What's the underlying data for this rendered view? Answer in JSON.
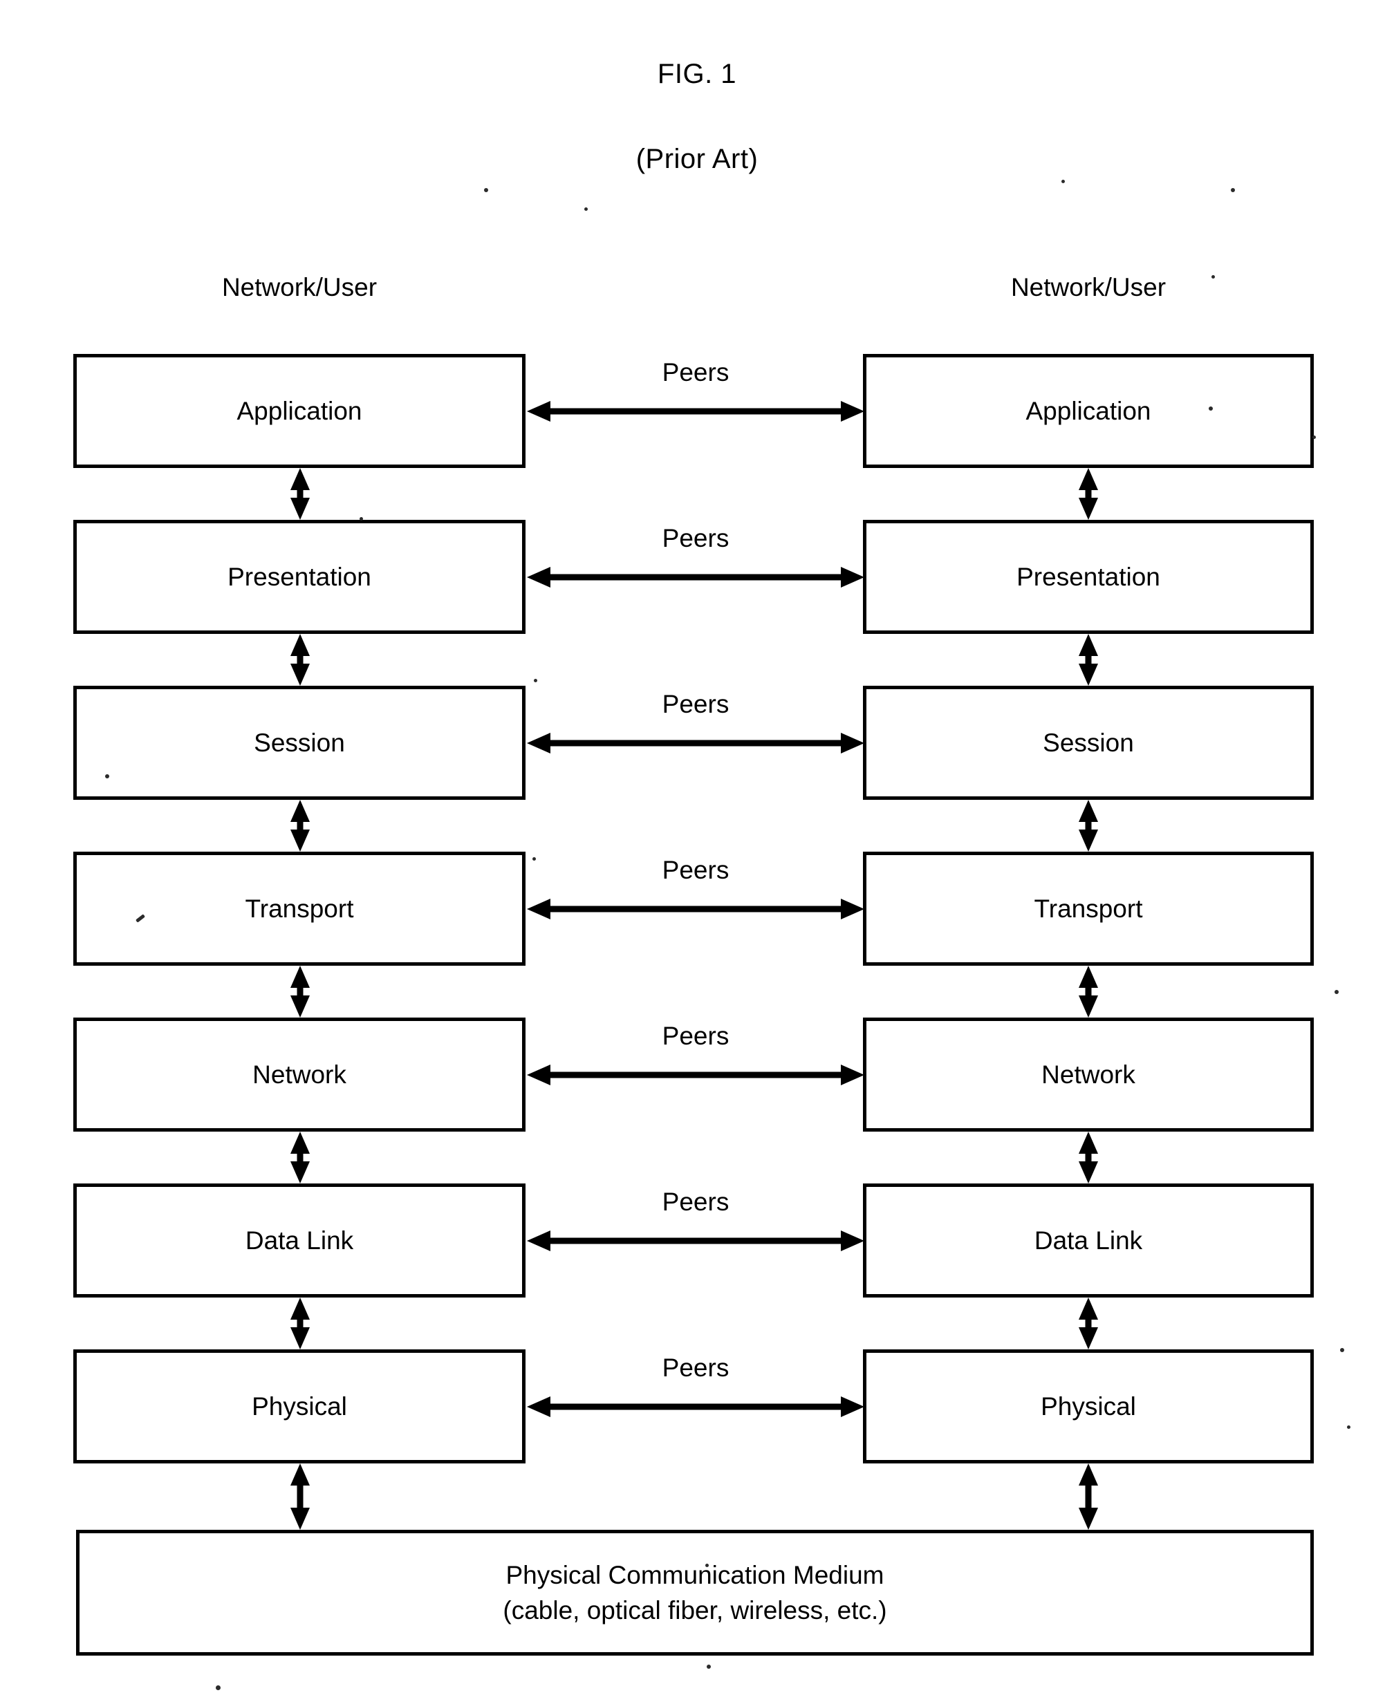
{
  "figure": {
    "label": "FIG. 1",
    "prior_art": "(Prior Art)"
  },
  "columns": {
    "left_header": "Network/User",
    "right_header": "Network/User"
  },
  "peer_link_label": "Peers",
  "layers": [
    {
      "name": "Application",
      "left_label": "Application",
      "right_label": "Application"
    },
    {
      "name": "Presentation",
      "left_label": "Presentation",
      "right_label": "Presentation"
    },
    {
      "name": "Session",
      "left_label": "Session",
      "right_label": "Session"
    },
    {
      "name": "Transport",
      "left_label": "Transport",
      "right_label": "Transport"
    },
    {
      "name": "Network",
      "left_label": "Network",
      "right_label": "Network"
    },
    {
      "name": "Data Link",
      "left_label": "Data Link",
      "right_label": "Data Link"
    },
    {
      "name": "Physical",
      "left_label": "Physical",
      "right_label": "Physical"
    }
  ],
  "peers": [
    "Peers",
    "Peers",
    "Peers",
    "Peers",
    "Peers",
    "Peers",
    "Peers"
  ],
  "medium": {
    "line1": "Physical Communication Medium",
    "line2": "(cable, optical fiber, wireless, etc.)"
  },
  "colors": {
    "stroke": "#000000",
    "background": "#ffffff"
  }
}
